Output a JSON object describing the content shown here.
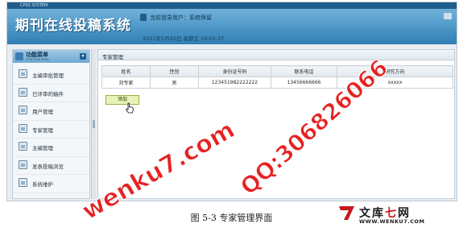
{
  "window": {
    "brand_strip": "CPSS SYSTEM"
  },
  "header": {
    "title": "期刊在线投稿系统",
    "user_status": "当前登录用户：系统保留",
    "datetime": "2011年5月20日 星期五  19:03:37"
  },
  "sidebar": {
    "title": "功能菜单",
    "subtitle": "FUNCTION MENU",
    "collapse_glyph": "▾",
    "items": [
      {
        "label": "主编审批管理",
        "icon": "document-icon"
      },
      {
        "label": "已评审的稿件",
        "icon": "document-icon"
      },
      {
        "label": "用户管理",
        "icon": "users-icon"
      },
      {
        "label": "专家管理",
        "icon": "expert-icon"
      },
      {
        "label": "主编管理",
        "icon": "editor-icon"
      },
      {
        "label": "发表投稿浏览",
        "icon": "browse-icon"
      },
      {
        "label": "系统维护",
        "icon": "settings-icon"
      }
    ]
  },
  "main": {
    "panel_title": "专家管理",
    "table": {
      "headers": [
        "姓名",
        "性别",
        "身份证号码",
        "联系电话",
        "研究方向"
      ],
      "rows": [
        [
          "刘专家",
          "男",
          "123451982222222",
          "13456666666",
          "xxxxx"
        ]
      ]
    },
    "add_button": "添加"
  },
  "watermark": {
    "site": "wenku7.com",
    "qq": "QQ:306826066"
  },
  "caption": "图 5-3 专家管理界面",
  "brand": {
    "cn_1": "文库",
    "cn_red": "七",
    "cn_2": "网",
    "url": "WWW.WENKU7.COM"
  },
  "colors": {
    "header_gradient_top": "#7eb8dc",
    "header_gradient_bottom": "#2f7fb5",
    "watermark": "#e62222",
    "add_button_bg": "#e8f3b8",
    "brand_red": "#c7161d"
  }
}
